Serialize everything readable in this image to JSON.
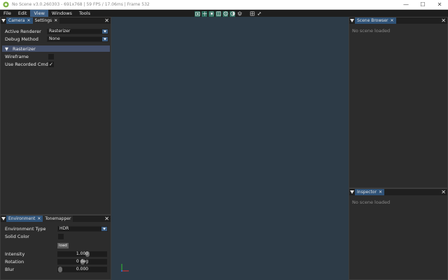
{
  "window": {
    "title": "No Scene v3.0.260303 - 691x768 | 59 FPS / 17.06ms | Frame 532",
    "minimize": "—",
    "maximize": "☐",
    "close": "✕"
  },
  "menu": [
    "File",
    "Edit",
    "View",
    "Windows",
    "Tools"
  ],
  "camera_panel": {
    "tabs": [
      "Camera",
      "Settings"
    ],
    "active_renderer_label": "Active Renderer",
    "active_renderer_value": "Rasterizer",
    "debug_method_label": "Debug Method",
    "debug_method_value": "None",
    "section_title": "Rasterizer",
    "wireframe_label": "Wireframe",
    "wireframe_checked": false,
    "use_recorded_label": "Use Recorded Cmd",
    "use_recorded_checked": true
  },
  "environment_panel": {
    "tabs": [
      "Environment",
      "Tonemapper"
    ],
    "env_type_label": "Environment Type",
    "env_type_value": "HDR",
    "solid_color_label": "Solid Color",
    "load_button": "load",
    "intensity_label": "Intensity",
    "intensity_value": "1.000",
    "rotation_label": "Rotation",
    "rotation_value": "0 deg",
    "blur_label": "Blur",
    "blur_value": "0.000"
  },
  "scene_browser": {
    "tab": "Scene Browser",
    "empty": "No scene loaded"
  },
  "inspector": {
    "tab": "Inspector",
    "empty": "No scene loaded"
  },
  "symbols": {
    "close": "✕",
    "check": "✓",
    "collapse": "▼"
  },
  "colors": {
    "accent": "#3c5d82",
    "viewport_bg": "#2d3b47",
    "panel_bg": "#2c2c2c",
    "section_header": "#45506a",
    "axis_x": "#e03030",
    "axis_y": "#30c030"
  },
  "icons": [
    "app-logo-icon",
    "camera-icon",
    "move-icon",
    "sun-icon",
    "grid-icon",
    "globe-icon",
    "contrast-icon",
    "layers-icon",
    "table-icon",
    "link-icon"
  ]
}
